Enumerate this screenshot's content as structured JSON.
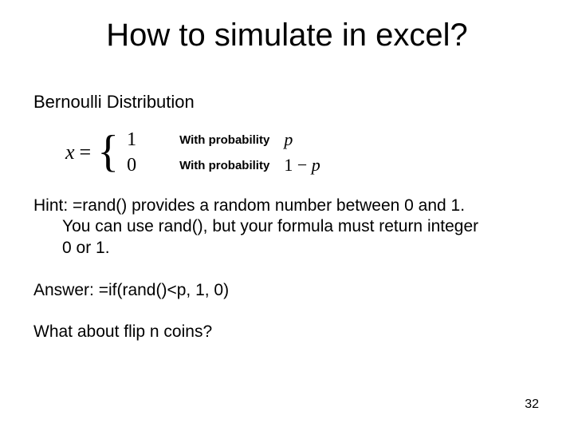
{
  "title": "How to simulate in excel?",
  "subtitle": "Bernoulli Distribution",
  "equation": {
    "lhs_var": "x",
    "equals": "=",
    "case1_value": "1",
    "case1_label": "With probability",
    "case1_prob": "p",
    "case2_value": "0",
    "case2_label": "With probability",
    "case2_prob_prefix": "1 − ",
    "case2_prob_var": "p"
  },
  "hint_line1": "Hint: =rand() provides a random number between 0 and 1.",
  "hint_line2": "You can use rand(), but your formula must return integer",
  "hint_line3": "0 or 1.",
  "answer": "Answer: =if(rand()<p, 1, 0)",
  "question2": "What about flip n coins?",
  "page_number": "32"
}
